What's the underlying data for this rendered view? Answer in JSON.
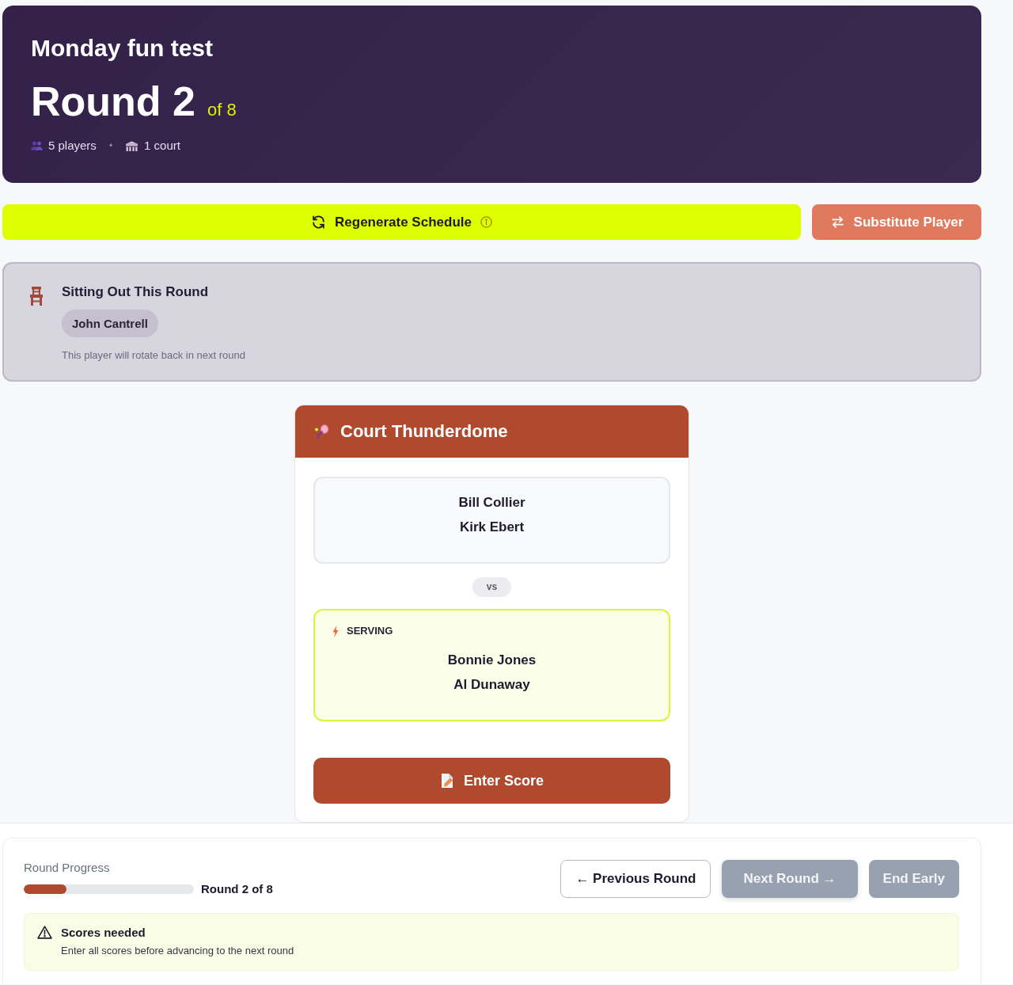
{
  "header": {
    "title": "Monday fun test",
    "round_label": "Round 2",
    "round_total": "of 8",
    "meta": [
      {
        "kind": "players",
        "text": "5 players"
      },
      {
        "kind": "courts",
        "text": "1 court"
      }
    ],
    "separator": "•"
  },
  "actions": [
    {
      "kind": "regenerate",
      "label": "Regenerate Schedule",
      "info": true
    },
    {
      "kind": "substitute",
      "label": "Substitute Player",
      "info": false
    }
  ],
  "sitting_out": {
    "title": "Sitting Out This Round",
    "players": [
      "John Cantrell"
    ],
    "note": "This player will rotate back in next round"
  },
  "courts": [
    {
      "name": "Court Thunderdome",
      "teams": [
        {
          "players": [
            "Bill Collier",
            "Kirk Ebert"
          ],
          "serving": false
        },
        {
          "players": [
            "Bonnie Jones",
            "Al Dunaway"
          ],
          "serving": true,
          "badge": "SERVING"
        }
      ],
      "versus": "vs",
      "action": "Enter Score"
    }
  ],
  "footer": {
    "progress": {
      "label": "Round Progress",
      "level": 0.25,
      "text": "Round 2 of 8"
    },
    "buttons": [
      {
        "kind": "outline",
        "label": "← Previous Round",
        "disabled": false
      },
      {
        "kind": "primary",
        "label": "Next Round →",
        "disabled": true
      },
      {
        "kind": "secondary",
        "label": "End Early",
        "disabled": true
      }
    ],
    "alert": {
      "title": "Scores needed",
      "message": "Enter all scores before advancing to the next round"
    }
  }
}
